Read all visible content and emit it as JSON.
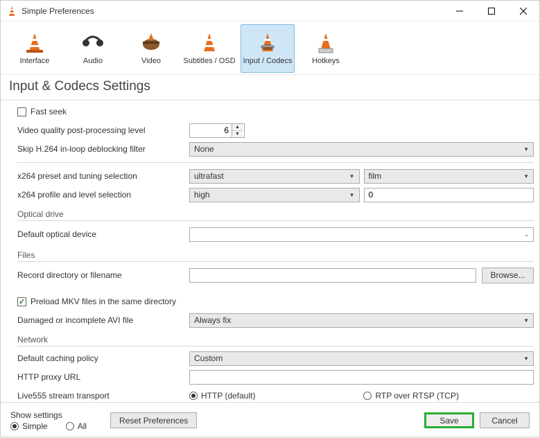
{
  "window": {
    "title": "Simple Preferences"
  },
  "toolbar": [
    {
      "label": "Interface"
    },
    {
      "label": "Audio"
    },
    {
      "label": "Video"
    },
    {
      "label": "Subtitles / OSD"
    },
    {
      "label": "Input / Codecs"
    },
    {
      "label": "Hotkeys"
    }
  ],
  "section_title": "Input & Codecs Settings",
  "codecs": {
    "fast_seek": "Fast seek",
    "video_quality_label": "Video quality post-processing level",
    "video_quality_value": "6",
    "skip_h264_label": "Skip H.264 in-loop deblocking filter",
    "skip_h264_value": "None",
    "x264_preset_label": "x264 preset and tuning selection",
    "x264_preset_value": "ultrafast",
    "x264_tuning_value": "film",
    "x264_profile_label": "x264 profile and level selection",
    "x264_profile_value": "high",
    "x264_level_value": "0"
  },
  "optical": {
    "title": "Optical drive",
    "default_device_label": "Default optical device",
    "default_device_value": ""
  },
  "files": {
    "title": "Files",
    "record_dir_label": "Record directory or filename",
    "record_dir_value": "",
    "browse_label": "Browse...",
    "preload_mkv_label": "Preload MKV files in the same directory",
    "damaged_avi_label": "Damaged or incomplete AVI file",
    "damaged_avi_value": "Always fix"
  },
  "network": {
    "title": "Network",
    "caching_label": "Default caching policy",
    "caching_value": "Custom",
    "proxy_label": "HTTP proxy URL",
    "proxy_value": "",
    "live555_label": "Live555 stream transport",
    "live555_http": "HTTP (default)",
    "live555_rtp": "RTP over RTSP (TCP)"
  },
  "footer": {
    "show_settings": "Show settings",
    "simple": "Simple",
    "all": "All",
    "reset": "Reset Preferences",
    "save": "Save",
    "cancel": "Cancel"
  }
}
